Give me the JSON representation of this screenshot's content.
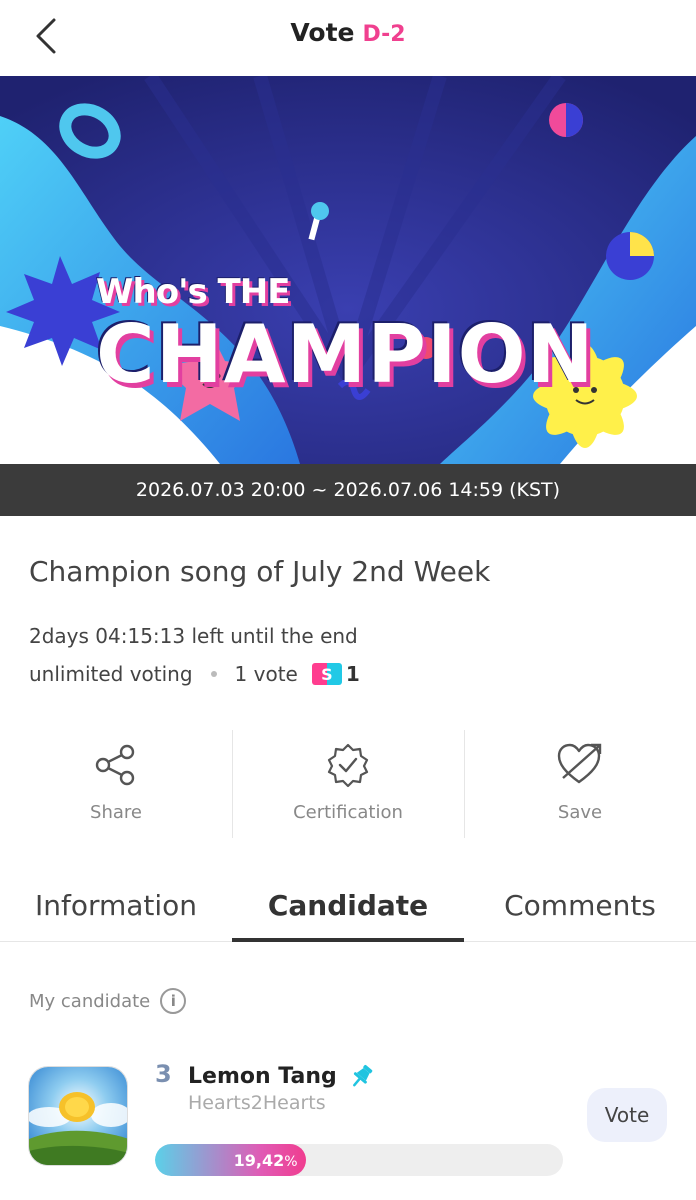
{
  "header": {
    "title": "Vote",
    "dday": "D-2"
  },
  "banner": {
    "title_small": "Who's THE",
    "title_big": "CHAMPION",
    "date_range": "2026.07.03 20:00 ~ 2026.07.06 14:59 (KST)"
  },
  "vote": {
    "title": "Champion song of July 2nd Week",
    "time_left": "2days 04:15:13 left until the end",
    "voting_type": "unlimited voting",
    "per_vote": "1 vote",
    "coin_symbol": "S",
    "coin_count": "1"
  },
  "actions": [
    {
      "label": "Share",
      "icon": "share-icon"
    },
    {
      "label": "Certification",
      "icon": "certification-badge-icon"
    },
    {
      "label": "Save",
      "icon": "heart-arrow-icon"
    }
  ],
  "tabs": [
    {
      "label": "Information",
      "active": false
    },
    {
      "label": "Candidate",
      "active": true
    },
    {
      "label": "Comments",
      "active": false
    }
  ],
  "my_candidate": {
    "section_label": "My candidate",
    "rank": "3",
    "name": "Lemon Tang",
    "artist": "Hearts2Hearts",
    "percent_text": "19,42",
    "percent_unit": "%",
    "percent_value": 19.42,
    "vote_button": "Vote"
  },
  "colors": {
    "accent_pink": "#f0408f",
    "date_bar": "#3b3b3b",
    "tab_underline": "#333333"
  }
}
